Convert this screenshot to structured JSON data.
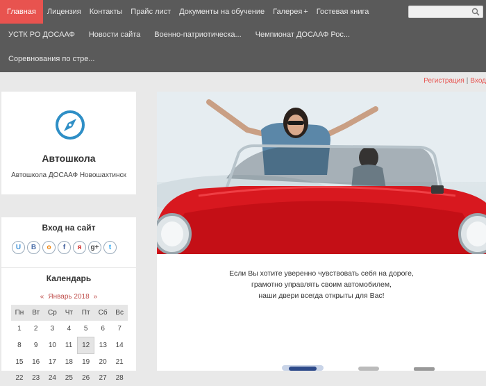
{
  "nav": {
    "row1": [
      "Главная",
      "Лицензия",
      "Контакты",
      "Прайс лист",
      "Документы на обучение",
      "Галерея",
      "Гостевая книга"
    ],
    "row2": [
      "УСТК РО ДОСААФ",
      "Новости сайта",
      "Военно-патриотическа...",
      "Чемпионат ДОСААФ Рос..."
    ],
    "row3": [
      "Соревнования по стре..."
    ],
    "active_index": 0,
    "gallery_expand": "+"
  },
  "search": {
    "placeholder": "",
    "icon": "search-icon"
  },
  "auth": {
    "register": "Регистрация",
    "separator": "|",
    "login": "Вход"
  },
  "site": {
    "title": "Автошкола",
    "subtitle": "Автошкола ДОСААФ Новошахтинск",
    "logo_icon": "compass-icon"
  },
  "login_block": {
    "title": "Вход на сайт",
    "socials": [
      {
        "label": "U",
        "icon": "ucoz-icon",
        "color": "#3b8fd6"
      },
      {
        "label": "B",
        "icon": "vkontakte-icon",
        "color": "#4a6ea9"
      },
      {
        "label": "о",
        "icon": "odnoklassniki-icon",
        "color": "#ee8208"
      },
      {
        "label": "f",
        "icon": "facebook-icon",
        "color": "#3b5998"
      },
      {
        "label": "я",
        "icon": "yandex-icon",
        "color": "#d13232"
      },
      {
        "label": "g+",
        "icon": "google-plus-icon",
        "color": "#444444"
      },
      {
        "label": "t",
        "icon": "twitter-icon",
        "color": "#1da1f2"
      }
    ]
  },
  "calendar": {
    "title": "Календарь",
    "prev": "«",
    "month": "Январь 2018",
    "next": "»",
    "weekdays": [
      "Пн",
      "Вт",
      "Ср",
      "Чт",
      "Пт",
      "Сб",
      "Вс"
    ],
    "weeks": [
      [
        "1",
        "2",
        "3",
        "4",
        "5",
        "6",
        "7"
      ],
      [
        "8",
        "9",
        "10",
        "11",
        "12",
        "13",
        "14"
      ],
      [
        "15",
        "16",
        "17",
        "18",
        "19",
        "20",
        "21"
      ],
      [
        "22",
        "23",
        "24",
        "25",
        "26",
        "27",
        "28"
      ]
    ],
    "today": "12"
  },
  "welcome": {
    "line1": "Если Вы хотите уверенно чувствовать себя на дороге,",
    "line2": "грамотно управлять своим автомобилем,",
    "line3": "наши двери всегда открыты для Вас!"
  },
  "colors": {
    "accent": "#e8534f",
    "nav_bg": "#5a5a5a",
    "page_bg": "#e9e9e9",
    "logo": "#2f8fc6"
  }
}
